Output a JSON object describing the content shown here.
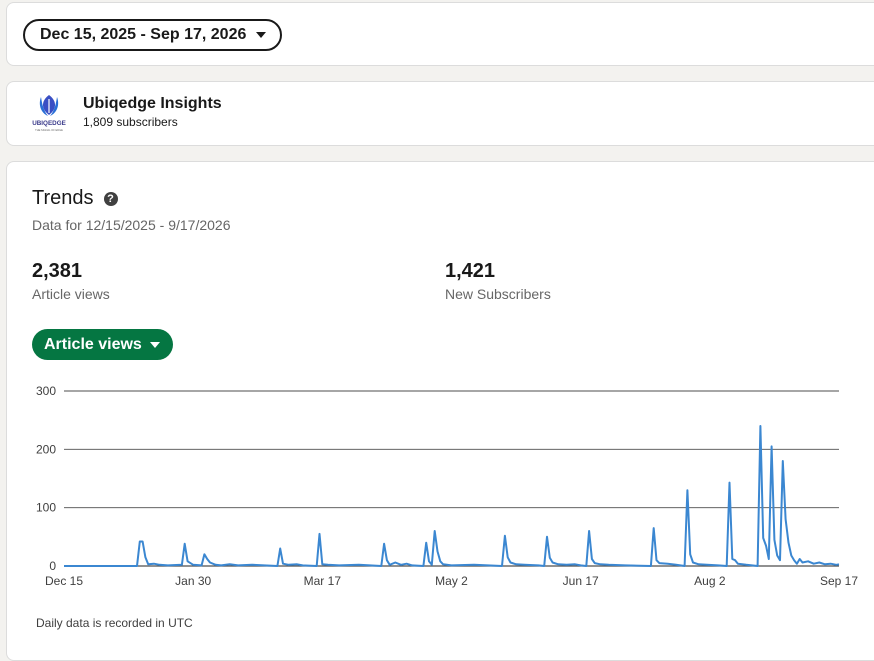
{
  "date_filter": {
    "label": "Dec 15, 2025 - Sep 17, 2026"
  },
  "publication": {
    "name": "Ubiqedge Insights",
    "subscribers": "1,809 subscribers",
    "logo_text": "UBIQEDGE",
    "logo_tagline": "THE SIGNAL OF EDGE"
  },
  "trends": {
    "title": "Trends",
    "range": "Data for 12/15/2025 - 9/17/2026",
    "metrics": [
      {
        "value": "2,381",
        "label": "Article views"
      },
      {
        "value": "1,421",
        "label": "New Subscribers"
      }
    ],
    "metric_selector": "Article views",
    "footnote": "Daily data is recorded in UTC"
  },
  "colors": {
    "line": "#3b87d1",
    "accent": "#057642",
    "grid": "#4d4d4d"
  },
  "chart_data": {
    "type": "line",
    "title": "",
    "xlabel": "",
    "ylabel": "",
    "ylim": [
      0,
      300
    ],
    "yticks": [
      0,
      100,
      200,
      300
    ],
    "x_tick_labels": [
      "Dec 15",
      "Jan 30",
      "Mar 17",
      "May 2",
      "Jun 17",
      "Aug 2",
      "Sep 17"
    ],
    "x_start": "2025-12-15",
    "x_end": "2026-09-17",
    "grid": true,
    "legend": "none",
    "series": [
      {
        "points": [
          [
            "2025-12-15",
            0
          ],
          [
            "2026-01-10",
            0
          ],
          [
            "2026-01-11",
            42
          ],
          [
            "2026-01-12",
            42
          ],
          [
            "2026-01-13",
            15
          ],
          [
            "2026-01-14",
            3
          ],
          [
            "2026-01-16",
            4
          ],
          [
            "2026-01-18",
            2
          ],
          [
            "2026-01-21",
            1
          ],
          [
            "2026-01-26",
            2
          ],
          [
            "2026-01-27",
            38
          ],
          [
            "2026-01-28",
            8
          ],
          [
            "2026-01-30",
            2
          ],
          [
            "2026-02-02",
            1
          ],
          [
            "2026-02-03",
            20
          ],
          [
            "2026-02-04",
            12
          ],
          [
            "2026-02-05",
            6
          ],
          [
            "2026-02-07",
            2
          ],
          [
            "2026-02-09",
            1
          ],
          [
            "2026-02-12",
            3
          ],
          [
            "2026-02-15",
            1
          ],
          [
            "2026-02-20",
            2
          ],
          [
            "2026-03-01",
            0
          ],
          [
            "2026-03-02",
            30
          ],
          [
            "2026-03-03",
            4
          ],
          [
            "2026-03-05",
            2
          ],
          [
            "2026-03-08",
            3
          ],
          [
            "2026-03-10",
            1
          ],
          [
            "2026-03-15",
            0
          ],
          [
            "2026-03-16",
            55
          ],
          [
            "2026-03-17",
            3
          ],
          [
            "2026-03-19",
            2
          ],
          [
            "2026-03-23",
            1
          ],
          [
            "2026-03-30",
            2
          ],
          [
            "2026-04-07",
            0
          ],
          [
            "2026-04-08",
            38
          ],
          [
            "2026-04-09",
            10
          ],
          [
            "2026-04-10",
            2
          ],
          [
            "2026-04-12",
            6
          ],
          [
            "2026-04-14",
            2
          ],
          [
            "2026-04-16",
            4
          ],
          [
            "2026-04-18",
            1
          ],
          [
            "2026-04-22",
            0
          ],
          [
            "2026-04-23",
            40
          ],
          [
            "2026-04-24",
            8
          ],
          [
            "2026-04-25",
            2
          ],
          [
            "2026-04-26",
            60
          ],
          [
            "2026-04-27",
            25
          ],
          [
            "2026-04-28",
            8
          ],
          [
            "2026-04-29",
            3
          ],
          [
            "2026-05-02",
            1
          ],
          [
            "2026-05-10",
            2
          ],
          [
            "2026-05-20",
            0
          ],
          [
            "2026-05-21",
            52
          ],
          [
            "2026-05-22",
            15
          ],
          [
            "2026-05-23",
            6
          ],
          [
            "2026-05-25",
            3
          ],
          [
            "2026-05-28",
            2
          ],
          [
            "2026-06-02",
            1
          ],
          [
            "2026-06-04",
            0
          ],
          [
            "2026-06-05",
            50
          ],
          [
            "2026-06-06",
            14
          ],
          [
            "2026-06-07",
            6
          ],
          [
            "2026-06-09",
            3
          ],
          [
            "2026-06-12",
            2
          ],
          [
            "2026-06-15",
            3
          ],
          [
            "2026-06-17",
            1
          ],
          [
            "2026-06-19",
            0
          ],
          [
            "2026-06-20",
            60
          ],
          [
            "2026-06-21",
            12
          ],
          [
            "2026-06-22",
            5
          ],
          [
            "2026-06-24",
            3
          ],
          [
            "2026-06-27",
            2
          ],
          [
            "2026-07-03",
            1
          ],
          [
            "2026-07-12",
            0
          ],
          [
            "2026-07-13",
            65
          ],
          [
            "2026-07-14",
            10
          ],
          [
            "2026-07-15",
            5
          ],
          [
            "2026-07-18",
            4
          ],
          [
            "2026-07-21",
            2
          ],
          [
            "2026-07-24",
            0
          ],
          [
            "2026-07-25",
            130
          ],
          [
            "2026-07-26",
            20
          ],
          [
            "2026-07-27",
            6
          ],
          [
            "2026-07-29",
            3
          ],
          [
            "2026-08-01",
            2
          ],
          [
            "2026-08-05",
            1
          ],
          [
            "2026-08-08",
            0
          ],
          [
            "2026-08-09",
            143
          ],
          [
            "2026-08-10",
            12
          ],
          [
            "2026-08-11",
            10
          ],
          [
            "2026-08-12",
            4
          ],
          [
            "2026-08-15",
            2
          ],
          [
            "2026-08-19",
            0
          ],
          [
            "2026-08-20",
            240
          ],
          [
            "2026-08-21",
            48
          ],
          [
            "2026-08-22",
            35
          ],
          [
            "2026-08-23",
            12
          ],
          [
            "2026-08-24",
            205
          ],
          [
            "2026-08-25",
            45
          ],
          [
            "2026-08-26",
            18
          ],
          [
            "2026-08-27",
            10
          ],
          [
            "2026-08-28",
            180
          ],
          [
            "2026-08-29",
            80
          ],
          [
            "2026-08-30",
            40
          ],
          [
            "2026-08-31",
            18
          ],
          [
            "2026-09-01",
            10
          ],
          [
            "2026-09-02",
            4
          ],
          [
            "2026-09-03",
            12
          ],
          [
            "2026-09-04",
            6
          ],
          [
            "2026-09-06",
            8
          ],
          [
            "2026-09-08",
            4
          ],
          [
            "2026-09-10",
            6
          ],
          [
            "2026-09-12",
            3
          ],
          [
            "2026-09-14",
            4
          ],
          [
            "2026-09-16",
            2
          ],
          [
            "2026-09-17",
            3
          ]
        ]
      }
    ]
  }
}
